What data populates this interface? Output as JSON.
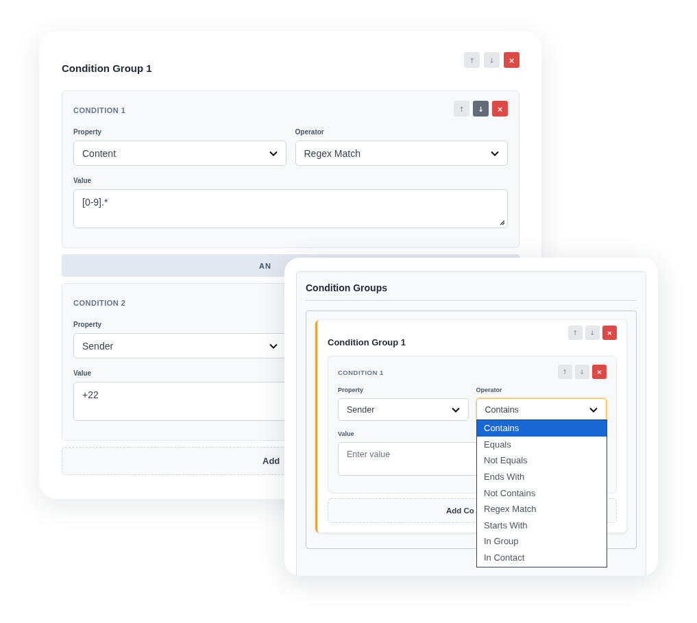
{
  "back_panel": {
    "group_title": "Condition Group 1",
    "group_buttons": [
      {
        "kind": "up",
        "label": "↑",
        "disabled": true
      },
      {
        "kind": "down",
        "label": "↓",
        "disabled": true
      },
      {
        "kind": "remove",
        "label": "×",
        "disabled": false
      }
    ],
    "conditions": [
      {
        "title": "CONDITION 1",
        "buttons": [
          {
            "kind": "up",
            "label": "↑",
            "disabled": true
          },
          {
            "kind": "down",
            "label": "↓",
            "disabled": false
          },
          {
            "kind": "remove",
            "label": "×",
            "disabled": false
          }
        ],
        "property_label": "Property",
        "property_value": "Content",
        "operator_label": "Operator",
        "operator_value": "Regex Match",
        "value_label": "Value",
        "value": "[0-9].*"
      },
      {
        "title": "CONDITION 2",
        "property_label": "Property",
        "property_value": "Sender",
        "value_label": "Value",
        "value": "+22"
      }
    ],
    "connector": "AN",
    "add_button": "Add"
  },
  "front_panel": {
    "title": "Condition Groups",
    "group": {
      "title": "Condition Group 1",
      "buttons": [
        {
          "kind": "up",
          "label": "↑",
          "disabled": true
        },
        {
          "kind": "down",
          "label": "↓",
          "disabled": true
        },
        {
          "kind": "remove",
          "label": "×",
          "disabled": false
        }
      ],
      "condition": {
        "title": "CONDITION 1",
        "buttons": [
          {
            "kind": "up",
            "label": "↑",
            "disabled": true
          },
          {
            "kind": "down",
            "label": "↓",
            "disabled": true
          },
          {
            "kind": "remove",
            "label": "×",
            "disabled": false
          }
        ],
        "property_label": "Property",
        "property_value": "Sender",
        "operator_label": "Operator",
        "operator_value": "Contains",
        "operator_focused": true,
        "value_label": "Value",
        "value_placeholder": "Enter value"
      },
      "add_button": "Add Co"
    },
    "operator_options": [
      {
        "label": "Contains",
        "selected": true
      },
      {
        "label": "Equals",
        "selected": false
      },
      {
        "label": "Not Equals",
        "selected": false
      },
      {
        "label": "Ends With",
        "selected": false
      },
      {
        "label": "Not Contains",
        "selected": false
      },
      {
        "label": "Regex Match",
        "selected": false
      },
      {
        "label": "Starts With",
        "selected": false
      },
      {
        "label": "In Group",
        "selected": false
      },
      {
        "label": "In Contact",
        "selected": false
      }
    ]
  }
}
